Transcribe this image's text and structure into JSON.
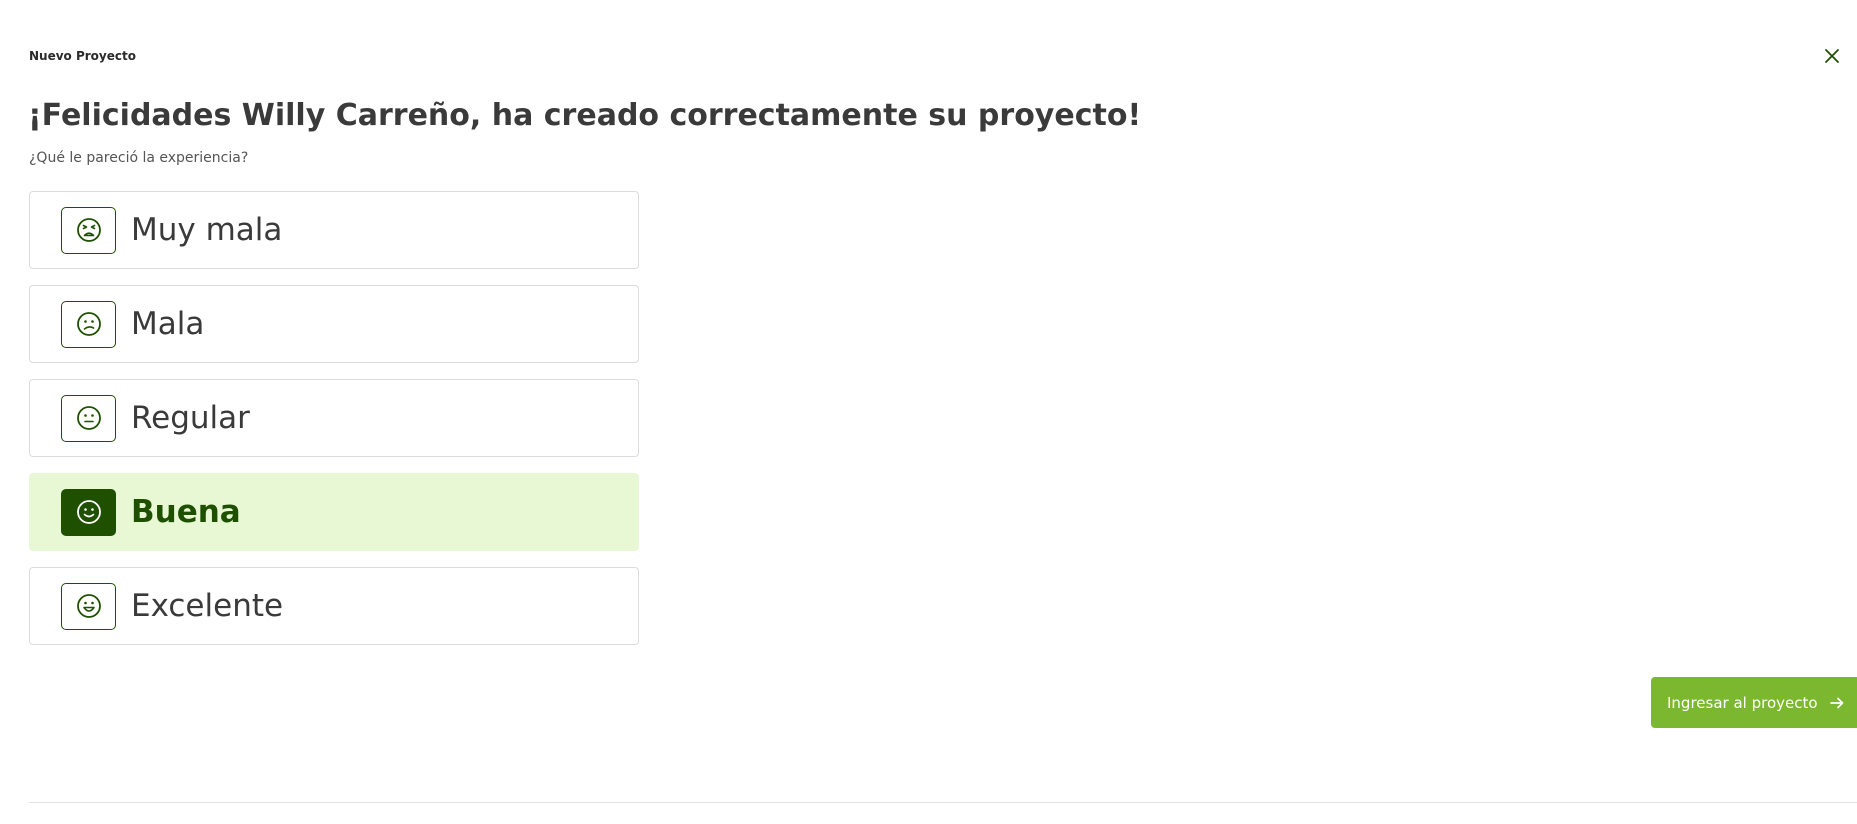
{
  "dialog": {
    "section_label": "Nuevo Proyecto",
    "close_icon": "close-icon",
    "headline": "¡Felicidades Willy Carreño, ha creado correctamente su proyecto!",
    "question": "¿Qué le pareció la experiencia?"
  },
  "ratings": {
    "selected": "Buena",
    "options": [
      {
        "label": "Muy mala",
        "icon": "very-sad-face-icon"
      },
      {
        "label": "Mala",
        "icon": "sad-face-icon"
      },
      {
        "label": "Regular",
        "icon": "neutral-face-icon"
      },
      {
        "label": "Buena",
        "icon": "smile-face-icon"
      },
      {
        "label": "Excelente",
        "icon": "grin-face-icon"
      }
    ]
  },
  "actions": {
    "enter_project_label": "Ingresar al proyecto",
    "enter_project_icon": "arrow-right-icon"
  },
  "colors": {
    "primary_dark_green": "#1f5000",
    "accent_green": "#7cb82f",
    "selected_background": "#e8f7d4",
    "text": "#3a3a3a"
  }
}
